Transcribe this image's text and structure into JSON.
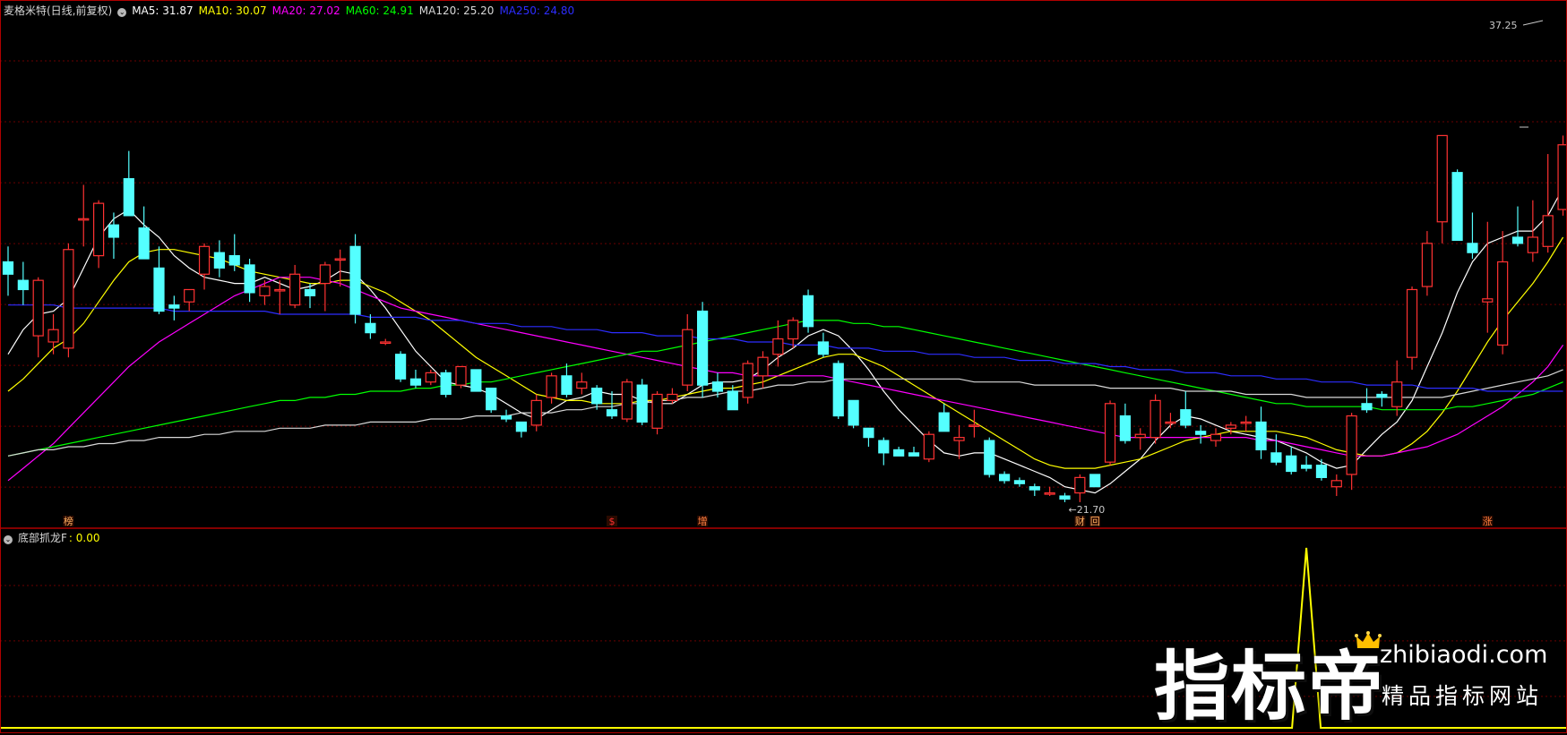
{
  "header": {
    "title": "麦格米特(日线,前复权)",
    "ma_values": [
      {
        "label": "MA5: 31.87",
        "color": "#ffffff"
      },
      {
        "label": "MA10: 30.07",
        "color": "#ffff00"
      },
      {
        "label": "MA20: 27.02",
        "color": "#ff00ff"
      },
      {
        "label": "MA60: 24.91",
        "color": "#00ff00"
      },
      {
        "label": "MA120: 25.20",
        "color": "#d8d8d8"
      },
      {
        "label": "MA250: 24.80",
        "color": "#2d2dff"
      }
    ]
  },
  "indicator_panel": {
    "name": "底部抓龙F",
    "value": ": 0.00",
    "value_color": "#ffff00"
  },
  "watermark": {
    "brand": "指标帝",
    "url": "zhibiaodi.com",
    "slogan": "精品指标网站"
  },
  "chart_data": {
    "type": "candlestick",
    "price_range": [
      21.0,
      38.0
    ],
    "grid": "dotted horizontal",
    "colors": {
      "up": "#ff3232",
      "down": "#54ffff",
      "frame": "#b00000"
    },
    "candles": [
      [
        29.5,
        30.0,
        28.4,
        29.1
      ],
      [
        28.9,
        29.5,
        28.1,
        28.6
      ],
      [
        27.1,
        29.0,
        26.4,
        28.9
      ],
      [
        26.9,
        27.8,
        26.5,
        27.3
      ],
      [
        26.7,
        30.1,
        26.4,
        29.9
      ],
      [
        30.9,
        32.0,
        30.0,
        30.9
      ],
      [
        29.7,
        31.5,
        29.3,
        31.4
      ],
      [
        30.7,
        31.1,
        29.6,
        30.3
      ],
      [
        32.2,
        33.1,
        31.2,
        31.0
      ],
      [
        30.6,
        31.3,
        29.6,
        29.6
      ],
      [
        29.3,
        30.0,
        27.8,
        27.9
      ],
      [
        28.1,
        28.4,
        27.6,
        28.0
      ],
      [
        28.2,
        28.6,
        27.9,
        28.6
      ],
      [
        29.1,
        30.1,
        28.6,
        30.0
      ],
      [
        29.8,
        30.2,
        29.0,
        29.3
      ],
      [
        29.7,
        30.4,
        29.2,
        29.4
      ],
      [
        29.4,
        29.6,
        28.2,
        28.5
      ],
      [
        28.4,
        28.9,
        28.1,
        28.7
      ],
      [
        28.6,
        28.9,
        27.8,
        28.6
      ],
      [
        28.1,
        29.4,
        28.0,
        29.1
      ],
      [
        28.6,
        28.8,
        28.0,
        28.4
      ],
      [
        28.8,
        29.5,
        27.9,
        29.4
      ],
      [
        29.6,
        29.9,
        28.7,
        29.6
      ],
      [
        30.0,
        30.4,
        27.5,
        27.8
      ],
      [
        27.5,
        27.8,
        27.0,
        27.2
      ],
      [
        26.9,
        27.0,
        26.8,
        26.9
      ],
      [
        26.5,
        26.6,
        25.6,
        25.7
      ],
      [
        25.7,
        26.0,
        25.4,
        25.5
      ],
      [
        25.6,
        26.0,
        25.5,
        25.9
      ],
      [
        25.9,
        26.0,
        25.1,
        25.2
      ],
      [
        25.5,
        26.1,
        25.4,
        26.1
      ],
      [
        26.0,
        26.0,
        25.3,
        25.3
      ],
      [
        25.4,
        25.4,
        24.6,
        24.7
      ],
      [
        24.5,
        24.7,
        24.3,
        24.4
      ],
      [
        24.3,
        24.3,
        23.8,
        24.0
      ],
      [
        24.2,
        25.2,
        24.0,
        25.0
      ],
      [
        25.1,
        25.9,
        24.9,
        25.8
      ],
      [
        25.8,
        26.2,
        25.1,
        25.2
      ],
      [
        25.4,
        25.9,
        25.2,
        25.6
      ],
      [
        25.4,
        25.5,
        24.7,
        24.9
      ],
      [
        24.7,
        25.3,
        24.4,
        24.5
      ],
      [
        24.4,
        25.7,
        24.3,
        25.6
      ],
      [
        25.5,
        25.7,
        24.2,
        24.3
      ],
      [
        24.1,
        25.3,
        23.9,
        25.2
      ],
      [
        25.0,
        25.4,
        24.9,
        25.2
      ],
      [
        25.5,
        27.8,
        25.3,
        27.3
      ],
      [
        27.9,
        28.2,
        25.1,
        25.5
      ],
      [
        25.6,
        25.9,
        25.1,
        25.3
      ],
      [
        25.3,
        25.5,
        24.7,
        24.7
      ],
      [
        25.1,
        26.3,
        24.9,
        26.2
      ],
      [
        25.8,
        26.6,
        25.4,
        26.4
      ],
      [
        26.5,
        27.6,
        26.1,
        27.0
      ],
      [
        27.0,
        27.7,
        26.7,
        27.6
      ],
      [
        28.4,
        28.6,
        27.2,
        27.4
      ],
      [
        26.9,
        27.2,
        26.4,
        26.5
      ],
      [
        26.2,
        26.3,
        24.4,
        24.5
      ],
      [
        25.0,
        25.0,
        24.1,
        24.2
      ],
      [
        24.1,
        24.1,
        23.5,
        23.8
      ],
      [
        23.7,
        23.8,
        22.9,
        23.3
      ],
      [
        23.4,
        23.5,
        23.2,
        23.2
      ],
      [
        23.3,
        23.5,
        23.2,
        23.2
      ],
      [
        23.1,
        24.0,
        23.0,
        23.9
      ],
      [
        24.6,
        24.9,
        24.0,
        24.0
      ],
      [
        23.7,
        24.2,
        23.1,
        23.8
      ],
      [
        24.2,
        24.7,
        23.8,
        24.2
      ],
      [
        23.7,
        23.8,
        22.5,
        22.6
      ],
      [
        22.6,
        22.7,
        22.3,
        22.4
      ],
      [
        22.4,
        22.5,
        22.2,
        22.3
      ],
      [
        22.2,
        22.3,
        21.9,
        22.1
      ],
      [
        22.0,
        22.2,
        21.9,
        22.0
      ],
      [
        21.9,
        22.0,
        21.7,
        21.8
      ],
      [
        22.0,
        22.6,
        21.7,
        22.5
      ],
      [
        22.6,
        22.6,
        22.2,
        22.2
      ],
      [
        23.0,
        25.0,
        22.9,
        24.9
      ],
      [
        24.5,
        24.9,
        23.6,
        23.7
      ],
      [
        23.8,
        24.1,
        23.4,
        23.9
      ],
      [
        23.8,
        25.2,
        23.6,
        25.0
      ],
      [
        24.3,
        24.6,
        24.1,
        24.3
      ],
      [
        24.7,
        25.3,
        24.1,
        24.2
      ],
      [
        24.0,
        24.2,
        23.6,
        23.9
      ],
      [
        23.7,
        24.1,
        23.5,
        23.9
      ],
      [
        24.1,
        24.3,
        23.9,
        24.2
      ],
      [
        24.3,
        24.5,
        24.0,
        24.3
      ],
      [
        24.3,
        24.8,
        23.1,
        23.4
      ],
      [
        23.3,
        23.9,
        22.9,
        23.0
      ],
      [
        23.2,
        23.5,
        22.6,
        22.7
      ],
      [
        22.9,
        23.2,
        22.7,
        22.8
      ],
      [
        22.9,
        23.1,
        22.4,
        22.5
      ],
      [
        22.2,
        22.6,
        21.9,
        22.4
      ],
      [
        22.6,
        24.6,
        22.1,
        24.5
      ],
      [
        24.9,
        25.4,
        24.6,
        24.7
      ],
      [
        25.2,
        25.3,
        24.8,
        25.1
      ],
      [
        24.8,
        26.3,
        24.5,
        25.6
      ],
      [
        26.4,
        28.7,
        26.0,
        28.6
      ],
      [
        28.7,
        30.5,
        28.4,
        30.1
      ],
      [
        30.8,
        32.2,
        30.1,
        33.6
      ],
      [
        32.4,
        32.5,
        31.5,
        30.2
      ],
      [
        30.1,
        31.1,
        29.6,
        29.8
      ],
      [
        28.2,
        30.8,
        27.2,
        28.3
      ],
      [
        26.8,
        30.5,
        26.5,
        29.5
      ],
      [
        30.3,
        31.3,
        30.0,
        30.1
      ],
      [
        29.8,
        31.5,
        29.5,
        30.3
      ],
      [
        30.0,
        33.0,
        29.8,
        31.0
      ],
      [
        31.2,
        33.6,
        31.0,
        33.3
      ]
    ],
    "ma_lines": [
      {
        "name": "MA5",
        "color": "#ffffff",
        "values": [
          26.5,
          27.3,
          27.8,
          27.9,
          28.3,
          29.3,
          30.3,
          30.9,
          31.2,
          30.7,
          30.3,
          29.7,
          29.3,
          29.0,
          28.9,
          28.8,
          28.8,
          29.0,
          28.8,
          28.6,
          28.7,
          28.9,
          29.2,
          29.1,
          28.6,
          28.0,
          27.3,
          26.6,
          26.1,
          25.6,
          25.5,
          25.4,
          25.2,
          24.9,
          24.6,
          24.4,
          24.7,
          25.0,
          25.1,
          25.3,
          25.2,
          25.2,
          25.0,
          24.9,
          24.9,
          25.2,
          25.5,
          25.6,
          25.6,
          25.7,
          26.0,
          26.4,
          26.7,
          27.1,
          27.3,
          27.1,
          26.6,
          26.0,
          25.3,
          24.7,
          24.2,
          23.7,
          23.3,
          23.2,
          23.3,
          23.3,
          23.1,
          22.9,
          22.7,
          22.5,
          22.2,
          22.1,
          22.0,
          22.3,
          22.7,
          23.1,
          23.7,
          24.2,
          24.5,
          24.4,
          24.2,
          24.0,
          23.9,
          23.8,
          23.7,
          23.5,
          23.3,
          23.0,
          22.8,
          22.9,
          23.4,
          23.9,
          24.3,
          25.0,
          26.1,
          27.2,
          28.5,
          29.5,
          30.1,
          30.3,
          30.5,
          30.5,
          31.0,
          31.9
        ]
      },
      {
        "name": "MA10",
        "color": "#ffff00",
        "values": [
          25.3,
          25.7,
          26.2,
          26.7,
          27.0,
          27.5,
          28.2,
          28.9,
          29.5,
          29.8,
          29.9,
          29.9,
          29.8,
          29.7,
          29.6,
          29.4,
          29.2,
          29.1,
          29.0,
          28.9,
          28.8,
          28.8,
          28.9,
          28.9,
          28.7,
          28.5,
          28.2,
          27.9,
          27.6,
          27.2,
          26.8,
          26.4,
          26.1,
          25.8,
          25.5,
          25.2,
          25.1,
          25.0,
          25.0,
          24.9,
          24.9,
          24.9,
          25.0,
          25.0,
          25.1,
          25.2,
          25.3,
          25.4,
          25.4,
          25.5,
          25.6,
          25.8,
          26.0,
          26.2,
          26.4,
          26.5,
          26.5,
          26.3,
          26.1,
          25.8,
          25.5,
          25.2,
          24.9,
          24.6,
          24.3,
          24.0,
          23.7,
          23.4,
          23.1,
          22.9,
          22.8,
          22.8,
          22.8,
          22.9,
          23.0,
          23.1,
          23.3,
          23.5,
          23.7,
          23.8,
          23.9,
          24.0,
          24.0,
          24.0,
          24.0,
          23.9,
          23.8,
          23.6,
          23.4,
          23.3,
          23.2,
          23.2,
          23.3,
          23.6,
          24.0,
          24.6,
          25.3,
          26.1,
          26.9,
          27.6,
          28.2,
          28.8,
          29.5,
          30.3
        ]
      },
      {
        "name": "MA20",
        "color": "#ff00ff",
        "values": [
          22.4,
          22.8,
          23.2,
          23.6,
          24.1,
          24.6,
          25.1,
          25.6,
          26.1,
          26.5,
          26.9,
          27.2,
          27.5,
          27.8,
          28.1,
          28.4,
          28.6,
          28.8,
          29.0,
          29.0,
          29.0,
          28.9,
          28.8,
          28.6,
          28.4,
          28.2,
          28.0,
          27.9,
          27.8,
          27.7,
          27.6,
          27.5,
          27.4,
          27.3,
          27.2,
          27.1,
          27.0,
          26.9,
          26.8,
          26.7,
          26.6,
          26.5,
          26.4,
          26.3,
          26.2,
          26.1,
          26.0,
          25.9,
          25.9,
          25.8,
          25.8,
          25.8,
          25.8,
          25.8,
          25.8,
          25.7,
          25.6,
          25.5,
          25.4,
          25.3,
          25.2,
          25.1,
          25.0,
          24.9,
          24.8,
          24.7,
          24.6,
          24.5,
          24.4,
          24.3,
          24.2,
          24.1,
          24.0,
          23.9,
          23.8,
          23.8,
          23.8,
          23.8,
          23.8,
          23.8,
          23.8,
          23.8,
          23.8,
          23.7,
          23.7,
          23.6,
          23.5,
          23.4,
          23.3,
          23.2,
          23.2,
          23.2,
          23.3,
          23.4,
          23.5,
          23.7,
          23.9,
          24.2,
          24.5,
          24.8,
          25.2,
          25.6,
          26.1,
          26.8
        ]
      },
      {
        "name": "MA60",
        "color": "#00ff00",
        "values": [
          23.2,
          23.3,
          23.4,
          23.5,
          23.6,
          23.7,
          23.8,
          23.9,
          24.0,
          24.1,
          24.2,
          24.3,
          24.4,
          24.5,
          24.6,
          24.7,
          24.8,
          24.9,
          25.0,
          25.0,
          25.1,
          25.1,
          25.2,
          25.2,
          25.3,
          25.3,
          25.3,
          25.4,
          25.4,
          25.5,
          25.5,
          25.6,
          25.6,
          25.7,
          25.8,
          25.9,
          26.0,
          26.1,
          26.2,
          26.3,
          26.4,
          26.5,
          26.6,
          26.6,
          26.7,
          26.8,
          26.9,
          27.0,
          27.1,
          27.2,
          27.3,
          27.4,
          27.5,
          27.6,
          27.6,
          27.6,
          27.5,
          27.5,
          27.4,
          27.4,
          27.3,
          27.2,
          27.1,
          27.0,
          26.9,
          26.8,
          26.7,
          26.6,
          26.5,
          26.4,
          26.3,
          26.2,
          26.1,
          26.0,
          25.9,
          25.8,
          25.7,
          25.6,
          25.5,
          25.4,
          25.3,
          25.2,
          25.1,
          25.0,
          24.9,
          24.9,
          24.8,
          24.8,
          24.8,
          24.8,
          24.8,
          24.7,
          24.7,
          24.7,
          24.7,
          24.7,
          24.8,
          24.8,
          24.9,
          25.0,
          25.1,
          25.2,
          25.4,
          25.6
        ]
      },
      {
        "name": "MA120",
        "color": "#d8d8d8",
        "values": [
          23.2,
          23.3,
          23.4,
          23.4,
          23.5,
          23.5,
          23.6,
          23.6,
          23.7,
          23.7,
          23.8,
          23.8,
          23.8,
          23.9,
          23.9,
          24.0,
          24.0,
          24.0,
          24.1,
          24.1,
          24.1,
          24.2,
          24.2,
          24.2,
          24.3,
          24.3,
          24.3,
          24.3,
          24.4,
          24.4,
          24.4,
          24.5,
          24.5,
          24.5,
          24.6,
          24.6,
          24.6,
          24.7,
          24.7,
          24.8,
          24.8,
          24.9,
          24.9,
          25.0,
          25.0,
          25.1,
          25.1,
          25.2,
          25.3,
          25.3,
          25.4,
          25.5,
          25.5,
          25.6,
          25.6,
          25.7,
          25.7,
          25.7,
          25.7,
          25.7,
          25.7,
          25.7,
          25.7,
          25.7,
          25.6,
          25.6,
          25.6,
          25.6,
          25.5,
          25.5,
          25.5,
          25.5,
          25.5,
          25.4,
          25.4,
          25.4,
          25.4,
          25.4,
          25.3,
          25.3,
          25.3,
          25.3,
          25.2,
          25.2,
          25.2,
          25.2,
          25.1,
          25.1,
          25.1,
          25.1,
          25.1,
          25.1,
          25.1,
          25.1,
          25.1,
          25.1,
          25.2,
          25.3,
          25.4,
          25.5,
          25.6,
          25.7,
          25.8,
          26.0
        ]
      },
      {
        "name": "MA250",
        "color": "#2d2dff",
        "values": [
          28.1,
          28.1,
          28.1,
          28.1,
          28.0,
          28.0,
          28.0,
          28.0,
          28.0,
          28.0,
          28.0,
          27.9,
          27.9,
          27.9,
          27.9,
          27.9,
          27.9,
          27.9,
          27.8,
          27.8,
          27.8,
          27.8,
          27.8,
          27.8,
          27.7,
          27.7,
          27.7,
          27.7,
          27.6,
          27.6,
          27.6,
          27.5,
          27.5,
          27.5,
          27.4,
          27.4,
          27.4,
          27.3,
          27.3,
          27.3,
          27.2,
          27.2,
          27.2,
          27.1,
          27.1,
          27.1,
          27.0,
          27.0,
          27.0,
          26.9,
          26.9,
          26.9,
          26.8,
          26.8,
          26.8,
          26.7,
          26.7,
          26.7,
          26.6,
          26.6,
          26.6,
          26.5,
          26.5,
          26.5,
          26.4,
          26.4,
          26.4,
          26.3,
          26.3,
          26.3,
          26.2,
          26.2,
          26.2,
          26.1,
          26.1,
          26.0,
          26.0,
          26.0,
          25.9,
          25.9,
          25.9,
          25.8,
          25.8,
          25.8,
          25.7,
          25.7,
          25.7,
          25.6,
          25.6,
          25.6,
          25.5,
          25.5,
          25.5,
          25.5,
          25.4,
          25.4,
          25.4,
          25.4,
          25.3,
          25.3,
          25.3,
          25.3,
          25.3,
          25.3
        ]
      }
    ],
    "annotations": {
      "high_label": "37.25",
      "low_label": "21.70",
      "low_index": 70
    },
    "event_markers": [
      {
        "index": 4,
        "label": "榜",
        "color": "#ffb060"
      },
      {
        "index": 40,
        "label": "$",
        "color": "#ff3030"
      },
      {
        "index": 46,
        "label": "增",
        "color": "#ff8040"
      },
      {
        "index": 71,
        "label": "财",
        "color": "#ffb060"
      },
      {
        "index": 72,
        "label": "回",
        "color": "#ffb060"
      },
      {
        "index": 98,
        "label": "涨",
        "color": "#ff8040"
      }
    ],
    "indicator": {
      "name": "底部抓龙F",
      "color": "#ffff00",
      "spike_index": 86,
      "spike_value": 1
    }
  }
}
